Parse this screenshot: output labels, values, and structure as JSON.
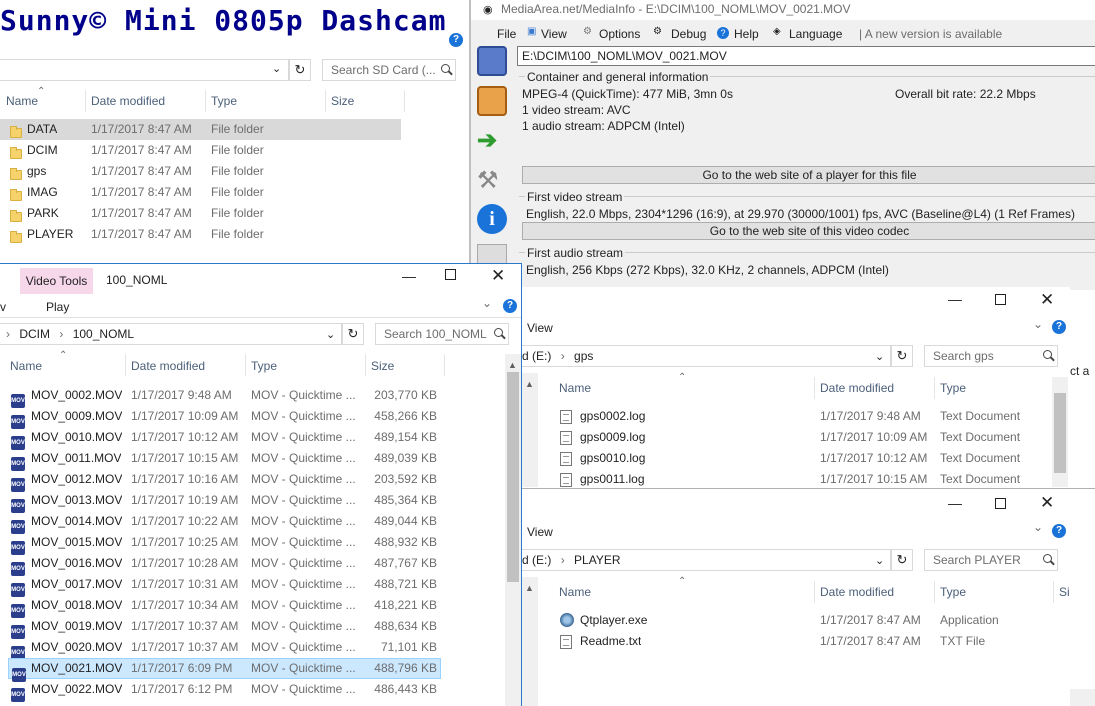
{
  "overlay_title": "Sunny© Mini 0805p Dashcam",
  "sdcard_window": {
    "search_placeholder": "Search SD Card (...",
    "columns": [
      "Name",
      "Date modified",
      "Type",
      "Size"
    ],
    "rows": [
      {
        "name": "DATA",
        "date": "1/17/2017 8:47 AM",
        "type": "File folder"
      },
      {
        "name": "DCIM",
        "date": "1/17/2017 8:47 AM",
        "type": "File folder"
      },
      {
        "name": "gps",
        "date": "1/17/2017 8:47 AM",
        "type": "File folder"
      },
      {
        "name": "IMAG",
        "date": "1/17/2017 8:47 AM",
        "type": "File folder"
      },
      {
        "name": "PARK",
        "date": "1/17/2017 8:47 AM",
        "type": "File folder"
      },
      {
        "name": "PLAYER",
        "date": "1/17/2017 8:47 AM",
        "type": "File folder"
      }
    ]
  },
  "mediainfo": {
    "title": "MediaArea.net/MediaInfo - E:\\DCIM\\100_NOML\\MOV_0021.MOV",
    "menu": [
      "File",
      "View",
      "Options",
      "Debug",
      "Help",
      "Language"
    ],
    "new_version": "| A new version is available",
    "path": "E:\\DCIM\\100_NOML\\MOV_0021.MOV",
    "general_header": "Container and general information",
    "general_line1": "MPEG-4 (QuickTime): 477 MiB, 3mn 0s",
    "overall_bitrate": "Overall bit rate: 22.2 Mbps",
    "general_line2": "1 video stream: AVC",
    "general_line3": "1 audio stream: ADPCM (Intel)",
    "player_button": "Go to the web site of a player for this file",
    "video_header": "First video stream",
    "video_line": "English, 22.0 Mbps, 2304*1296 (16:9), at 29.970 (30000/1001) fps, AVC (Baseline@L4) (1 Ref Frames)",
    "codec_button": "Go to the web site of this video codec",
    "audio_header": "First audio stream",
    "audio_line": "English, 256 Kbps (272 Kbps), 32.0 KHz, 2 channels, ADPCM (Intel)"
  },
  "noml_window": {
    "ribbon_tab": "Video Tools",
    "title": "100_NOML",
    "play_tab": "Play",
    "left_fragment": "v",
    "breadcrumb": [
      "DCIM",
      "100_NOML"
    ],
    "search_placeholder": "Search 100_NOML",
    "columns": [
      "Name",
      "Date modified",
      "Type",
      "Size"
    ],
    "rows": [
      {
        "name": "MOV_0002.MOV",
        "date": "1/17/2017 9:48 AM",
        "type": "MOV - Quicktime ...",
        "size": "203,770 KB"
      },
      {
        "name": "MOV_0009.MOV",
        "date": "1/17/2017 10:09 AM",
        "type": "MOV - Quicktime ...",
        "size": "458,266 KB"
      },
      {
        "name": "MOV_0010.MOV",
        "date": "1/17/2017 10:12 AM",
        "type": "MOV - Quicktime ...",
        "size": "489,154 KB"
      },
      {
        "name": "MOV_0011.MOV",
        "date": "1/17/2017 10:15 AM",
        "type": "MOV - Quicktime ...",
        "size": "489,039 KB"
      },
      {
        "name": "MOV_0012.MOV",
        "date": "1/17/2017 10:16 AM",
        "type": "MOV - Quicktime ...",
        "size": "203,592 KB"
      },
      {
        "name": "MOV_0013.MOV",
        "date": "1/17/2017 10:19 AM",
        "type": "MOV - Quicktime ...",
        "size": "485,364 KB"
      },
      {
        "name": "MOV_0014.MOV",
        "date": "1/17/2017 10:22 AM",
        "type": "MOV - Quicktime ...",
        "size": "489,044 KB"
      },
      {
        "name": "MOV_0015.MOV",
        "date": "1/17/2017 10:25 AM",
        "type": "MOV - Quicktime ...",
        "size": "488,932 KB"
      },
      {
        "name": "MOV_0016.MOV",
        "date": "1/17/2017 10:28 AM",
        "type": "MOV - Quicktime ...",
        "size": "487,767 KB"
      },
      {
        "name": "MOV_0017.MOV",
        "date": "1/17/2017 10:31 AM",
        "type": "MOV - Quicktime ...",
        "size": "488,721 KB"
      },
      {
        "name": "MOV_0018.MOV",
        "date": "1/17/2017 10:34 AM",
        "type": "MOV - Quicktime ...",
        "size": "418,221 KB"
      },
      {
        "name": "MOV_0019.MOV",
        "date": "1/17/2017 10:37 AM",
        "type": "MOV - Quicktime ...",
        "size": "488,634 KB"
      },
      {
        "name": "MOV_0020.MOV",
        "date": "1/17/2017 10:37 AM",
        "type": "MOV - Quicktime ...",
        "size": "71,101 KB"
      },
      {
        "name": "MOV_0021.MOV",
        "date": "1/17/2017 6:09 PM",
        "type": "MOV - Quicktime ...",
        "size": "488,796 KB"
      },
      {
        "name": "MOV_0022.MOV",
        "date": "1/17/2017 6:12 PM",
        "type": "MOV - Quicktime ...",
        "size": "486,443 KB"
      }
    ]
  },
  "gps_window": {
    "view_tab": "View",
    "drive_fragment": "d (E:)",
    "folder": "gps",
    "search_placeholder": "Search gps",
    "overflow_text": "ct a",
    "columns": [
      "Name",
      "Date modified",
      "Type"
    ],
    "rows": [
      {
        "name": "gps0002.log",
        "date": "1/17/2017 9:48 AM",
        "type": "Text Document"
      },
      {
        "name": "gps0009.log",
        "date": "1/17/2017 10:09 AM",
        "type": "Text Document"
      },
      {
        "name": "gps0010.log",
        "date": "1/17/2017 10:12 AM",
        "type": "Text Document"
      },
      {
        "name": "gps0011.log",
        "date": "1/17/2017 10:15 AM",
        "type": "Text Document"
      }
    ]
  },
  "player_window": {
    "view_tab": "View",
    "drive_fragment": "d (E:)",
    "folder": "PLAYER",
    "search_placeholder": "Search PLAYER",
    "columns": [
      "Name",
      "Date modified",
      "Type",
      "Si"
    ],
    "rows": [
      {
        "name": "Qtplayer.exe",
        "date": "1/17/2017 8:47 AM",
        "type": "Application"
      },
      {
        "name": "Readme.txt",
        "date": "1/17/2017 8:47 AM",
        "type": "TXT File"
      }
    ]
  }
}
